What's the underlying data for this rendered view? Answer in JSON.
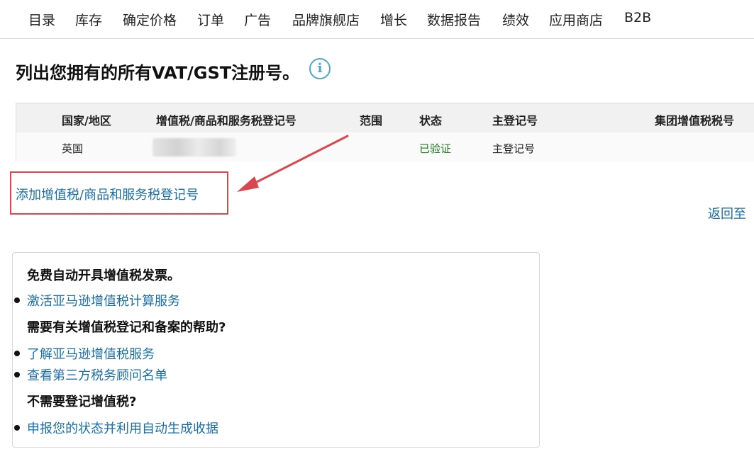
{
  "nav": {
    "items": [
      "目录",
      "库存",
      "确定价格",
      "订单",
      "广告",
      "品牌旗舰店",
      "增长",
      "数据报告",
      "绩效",
      "应用商店",
      "B2B"
    ]
  },
  "page": {
    "title": "列出您拥有的所有VAT/GST注册号。",
    "info_icon_glyph": "i"
  },
  "table": {
    "headers": [
      "国家/地区",
      "增值税/商品和服务税登记号",
      "范围",
      "状态",
      "主登记号",
      "集团增值税税号"
    ],
    "rows": [
      {
        "country": "英国",
        "status": "已验证",
        "primary": "主登记号"
      }
    ]
  },
  "actions": {
    "add_link": "添加增值税/商品和服务税登记号",
    "return_link": "返回至"
  },
  "help_box": {
    "sections": [
      {
        "heading": "免费自动开具增值税发票。",
        "links": [
          "激活亚马逊增值税计算服务"
        ]
      },
      {
        "heading": "需要有关增值税登记和备案的帮助?",
        "links": [
          "了解亚马逊增值税服务",
          "查看第三方税务顾问名单"
        ]
      },
      {
        "heading": "不需要登记增值税?",
        "links": [
          "申报您的状态并利用自动生成收据"
        ]
      }
    ]
  },
  "colors": {
    "link": "#1b6fa5",
    "verified": "#1f7a1f",
    "annotation_red": "#d9474f",
    "info_blue": "#4fa6c9"
  }
}
